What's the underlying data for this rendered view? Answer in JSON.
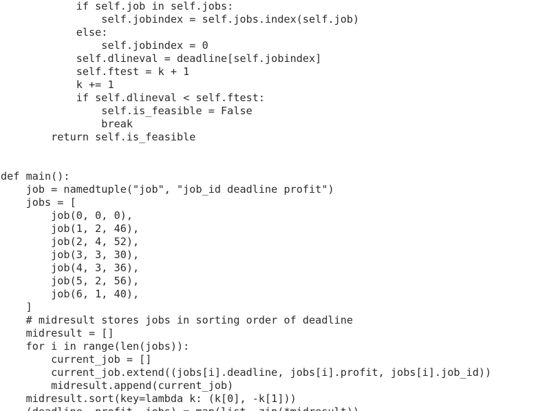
{
  "editor": {
    "lines": [
      "            if self.job in self.jobs:",
      "                self.jobindex = self.jobs.index(self.job)",
      "            else:",
      "                self.jobindex = 0",
      "            self.dlineval = deadline[self.jobindex]",
      "            self.ftest = k + 1",
      "            k += 1",
      "            if self.dlineval < self.ftest:",
      "                self.is_feasible = False",
      "                break",
      "        return self.is_feasible",
      "",
      "",
      "def main():",
      "    job = namedtuple(\"job\", \"job_id deadline profit\")",
      "    jobs = [",
      "        job(0, 0, 0),",
      "        job(1, 2, 46),",
      "        job(2, 4, 52),",
      "        job(3, 3, 30),",
      "        job(4, 3, 36),",
      "        job(5, 2, 56),",
      "        job(6, 1, 40),",
      "    ]",
      "    # midresult stores jobs in sorting order of deadline",
      "    midresult = []",
      "    for i in range(len(jobs)):",
      "        current_job = []",
      "        current_job.extend((jobs[i].deadline, jobs[i].profit, jobs[i].job_id))",
      "        midresult.append(current_job)",
      "    midresult.sort(key=lambda k: (k[0], -k[1]))",
      "    (deadline, profit, jobs) = map(list, zip(*midresult))"
    ]
  }
}
